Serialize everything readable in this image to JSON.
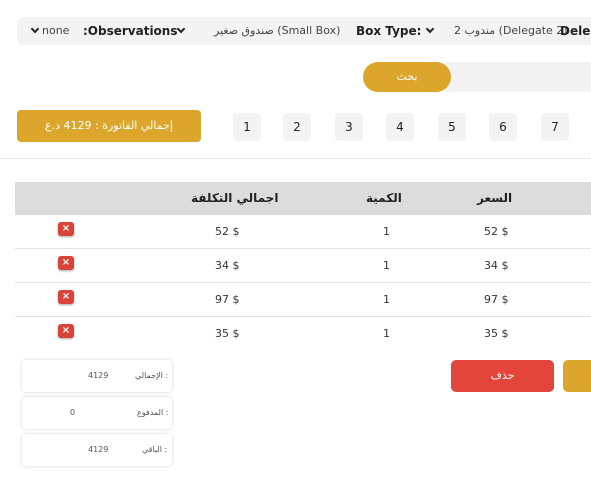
{
  "filters": {
    "delegate_label": "Dele",
    "delegate_value": "مندوب 2 (Delegate 2)",
    "box_type_label": "Box Type:",
    "box_type_value": "صندوق صغير (Small Box)",
    "observations_label": ":Observations",
    "observations_value": "none"
  },
  "search": {
    "button_label": "بحث",
    "input_value": ""
  },
  "invoice_total_label": "إجمالي الفاتورة : 4129 د.ع",
  "pagination": [
    "7",
    "6",
    "5",
    "4",
    "3",
    "2",
    "1"
  ],
  "table": {
    "headers": {
      "price": "السعر",
      "quantity": "الكمية",
      "total_cost": "اجمالي التكلفة"
    },
    "rows": [
      {
        "price": "52 $",
        "quantity": "1",
        "total": "52 $"
      },
      {
        "price": "34 $",
        "quantity": "1",
        "total": "34 $"
      },
      {
        "price": "97 $",
        "quantity": "1",
        "total": "97 $"
      },
      {
        "price": "35 $",
        "quantity": "1",
        "total": "35 $"
      }
    ],
    "delete_icon_glyph": "×"
  },
  "summary": {
    "total_label": "الإجمالي :",
    "total_value": "4129",
    "paid_label": "المدفوع :",
    "paid_value": "0",
    "remaining_label": "الباقي :",
    "remaining_value": "4129"
  },
  "actions": {
    "delete_label": "حذف"
  },
  "colors": {
    "accent_gold": "#dca52b",
    "danger_red": "#e4453b",
    "header_gray": "#dcdcdc"
  }
}
